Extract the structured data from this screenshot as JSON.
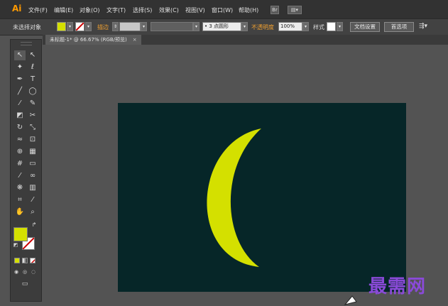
{
  "app": {
    "logo": "Ai",
    "accent_color": "#ff9a00"
  },
  "menu": [
    "文件(F)",
    "编辑(E)",
    "对象(O)",
    "文字(T)",
    "选择(S)",
    "效果(C)",
    "视图(V)",
    "窗口(W)",
    "帮助(H)"
  ],
  "menu_extras": {
    "bridge_label": "Br",
    "arrange_label": "▤▾"
  },
  "control": {
    "selection_label": "未选择对象",
    "fill_color": "#d4e000",
    "stroke_label": "描边",
    "stroke_value": "",
    "brush_label": "3 点圆形",
    "opacity_label": "不透明度",
    "opacity_value": "100%",
    "style_label": "样式",
    "doc_setup_button": "文档设置",
    "prefs_button": "首选项"
  },
  "document": {
    "tab_title": "未标题-1* @ 66.67% (RGB/预览)",
    "close_glyph": "×"
  },
  "toolbox": {
    "tools": [
      {
        "name": "selection-tool-icon",
        "glyph": "↖"
      },
      {
        "name": "direct-selection-tool-icon",
        "glyph": "↖"
      },
      {
        "name": "magic-wand-tool-icon",
        "glyph": "✦"
      },
      {
        "name": "lasso-tool-icon",
        "glyph": "ℓ"
      },
      {
        "name": "pen-tool-icon",
        "glyph": "✒"
      },
      {
        "name": "type-tool-icon",
        "glyph": "T"
      },
      {
        "name": "line-tool-icon",
        "glyph": "╱"
      },
      {
        "name": "ellipse-tool-icon",
        "glyph": "◯"
      },
      {
        "name": "paintbrush-tool-icon",
        "glyph": "⁄"
      },
      {
        "name": "pencil-tool-icon",
        "glyph": "✎"
      },
      {
        "name": "eraser-tool-icon",
        "glyph": "◩"
      },
      {
        "name": "scissors-tool-icon",
        "glyph": "✂"
      },
      {
        "name": "rotate-tool-icon",
        "glyph": "↻"
      },
      {
        "name": "scale-tool-icon",
        "glyph": "⤡"
      },
      {
        "name": "warp-tool-icon",
        "glyph": "≈"
      },
      {
        "name": "free-transform-tool-icon",
        "glyph": "⊡"
      },
      {
        "name": "shape-builder-tool-icon",
        "glyph": "⊕"
      },
      {
        "name": "perspective-grid-tool-icon",
        "glyph": "▦"
      },
      {
        "name": "mesh-tool-icon",
        "glyph": "#"
      },
      {
        "name": "gradient-tool-icon",
        "glyph": "▭"
      },
      {
        "name": "eyedropper-tool-icon",
        "glyph": "⁄"
      },
      {
        "name": "blend-tool-icon",
        "glyph": "∞"
      },
      {
        "name": "symbol-sprayer-tool-icon",
        "glyph": "❋"
      },
      {
        "name": "column-graph-tool-icon",
        "glyph": "▥"
      },
      {
        "name": "artboard-tool-icon",
        "glyph": "⌗"
      },
      {
        "name": "slice-tool-icon",
        "glyph": "⁄"
      },
      {
        "name": "hand-tool-icon",
        "glyph": "✋"
      },
      {
        "name": "zoom-tool-icon",
        "glyph": "⌕"
      }
    ],
    "fill_color": "#d4e000",
    "stroke_color": "#ffffff",
    "none_color": "#cc0000"
  },
  "artboard": {
    "background": "#062628",
    "shape_color": "#d4e000"
  },
  "watermark": "最需网"
}
